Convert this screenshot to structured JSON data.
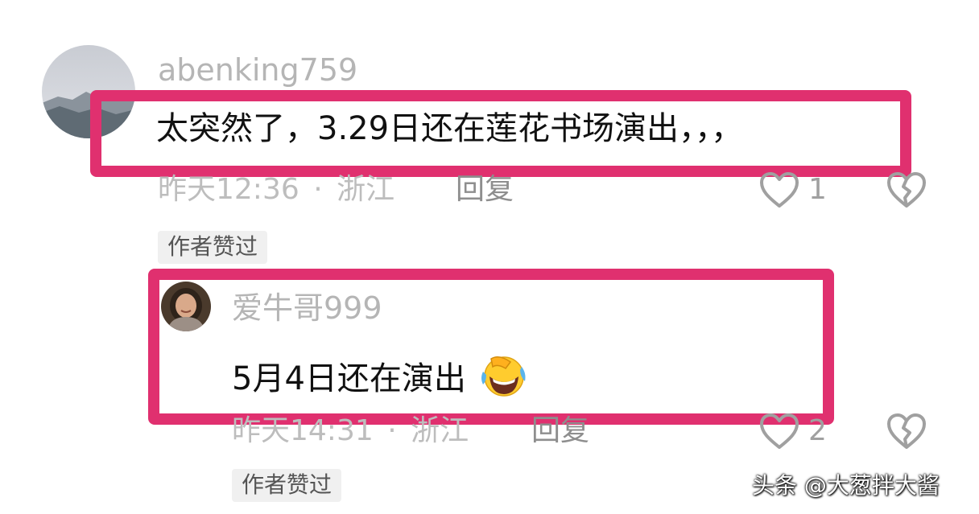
{
  "comments": [
    {
      "username": "abenking759",
      "content": "太突然了，3.29日还在莲花书场演出，，，",
      "time": "昨天12:36",
      "separator": "·",
      "location": "浙江",
      "reply_label": "回复",
      "likes": "1",
      "badge": "作者赞过",
      "avatar_icon": "landscape-avatar",
      "highlight_color": "#e0306f"
    },
    {
      "username": "爱牛哥999",
      "content": "5月4日还在演出",
      "emoji": "laughing-crying-emoji",
      "time": "昨天14:31",
      "separator": "·",
      "location": "浙江",
      "reply_label": "回复",
      "likes": "2",
      "badge": "作者赞过",
      "avatar_icon": "person-avatar",
      "highlight_color": "#e0306f"
    }
  ],
  "watermark": "头条 @大葱拌大酱"
}
